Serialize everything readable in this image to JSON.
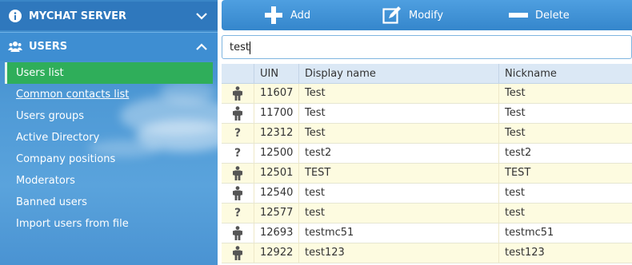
{
  "sidebar": {
    "server_title": "MYCHAT SERVER",
    "users_title": "USERS",
    "items": [
      {
        "label": "Users list",
        "active": true
      },
      {
        "label": "Common contacts list",
        "underline": true
      },
      {
        "label": "Users groups"
      },
      {
        "label": "Active Directory"
      },
      {
        "label": "Company positions"
      },
      {
        "label": "Moderators"
      },
      {
        "label": "Banned users"
      },
      {
        "label": "Import users from file"
      }
    ]
  },
  "toolbar": {
    "add_label": "Add",
    "modify_label": "Modify",
    "delete_label": "Delete"
  },
  "search": {
    "value": "test"
  },
  "table": {
    "columns": [
      "UIN",
      "Display name",
      "Nickname"
    ],
    "rows": [
      {
        "icon": "person-icon",
        "uin": "11607",
        "display_name": "Test",
        "nickname": "Test"
      },
      {
        "icon": "person-icon",
        "uin": "11700",
        "display_name": "Test",
        "nickname": "Test"
      },
      {
        "icon": "question-icon",
        "uin": "12312",
        "display_name": "Test",
        "nickname": "Test"
      },
      {
        "icon": "question-icon",
        "uin": "12500",
        "display_name": "test2",
        "nickname": "test2"
      },
      {
        "icon": "person-icon",
        "uin": "12501",
        "display_name": "TEST",
        "nickname": "TEST"
      },
      {
        "icon": "person-icon",
        "uin": "12540",
        "display_name": "test",
        "nickname": "test"
      },
      {
        "icon": "question-icon",
        "uin": "12577",
        "display_name": "test",
        "nickname": "test"
      },
      {
        "icon": "person-icon",
        "uin": "12693",
        "display_name": "testmc51",
        "nickname": "testmc51"
      },
      {
        "icon": "person-icon",
        "uin": "12922",
        "display_name": "test123",
        "nickname": "test123"
      }
    ]
  },
  "colors": {
    "active_item": "#2fae5a",
    "toolbar": "#3586cc",
    "row_yellow": "#fdfbe0",
    "header": "#dbe8f5"
  }
}
